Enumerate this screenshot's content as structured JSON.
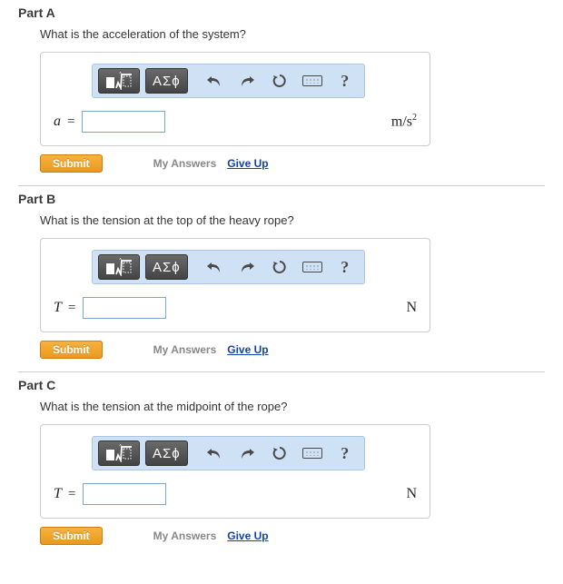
{
  "parts": [
    {
      "title": "Part A",
      "question": "What is the acceleration of the system?",
      "var": "a",
      "eq": " =",
      "value": "",
      "unit_html": "m/s²"
    },
    {
      "title": "Part B",
      "question": "What is the tension at the top of the heavy rope?",
      "var": "T",
      "eq": " =",
      "value": "",
      "unit_html": "N"
    },
    {
      "title": "Part C",
      "question": "What is the tension at the midpoint of the rope?",
      "var": "T",
      "eq": " =",
      "value": "",
      "unit_html": "N"
    }
  ],
  "toolbar": {
    "greek_label": "ΑΣϕ"
  },
  "actions": {
    "submit": "Submit",
    "my_answers": "My Answers",
    "give_up": "Give Up"
  }
}
